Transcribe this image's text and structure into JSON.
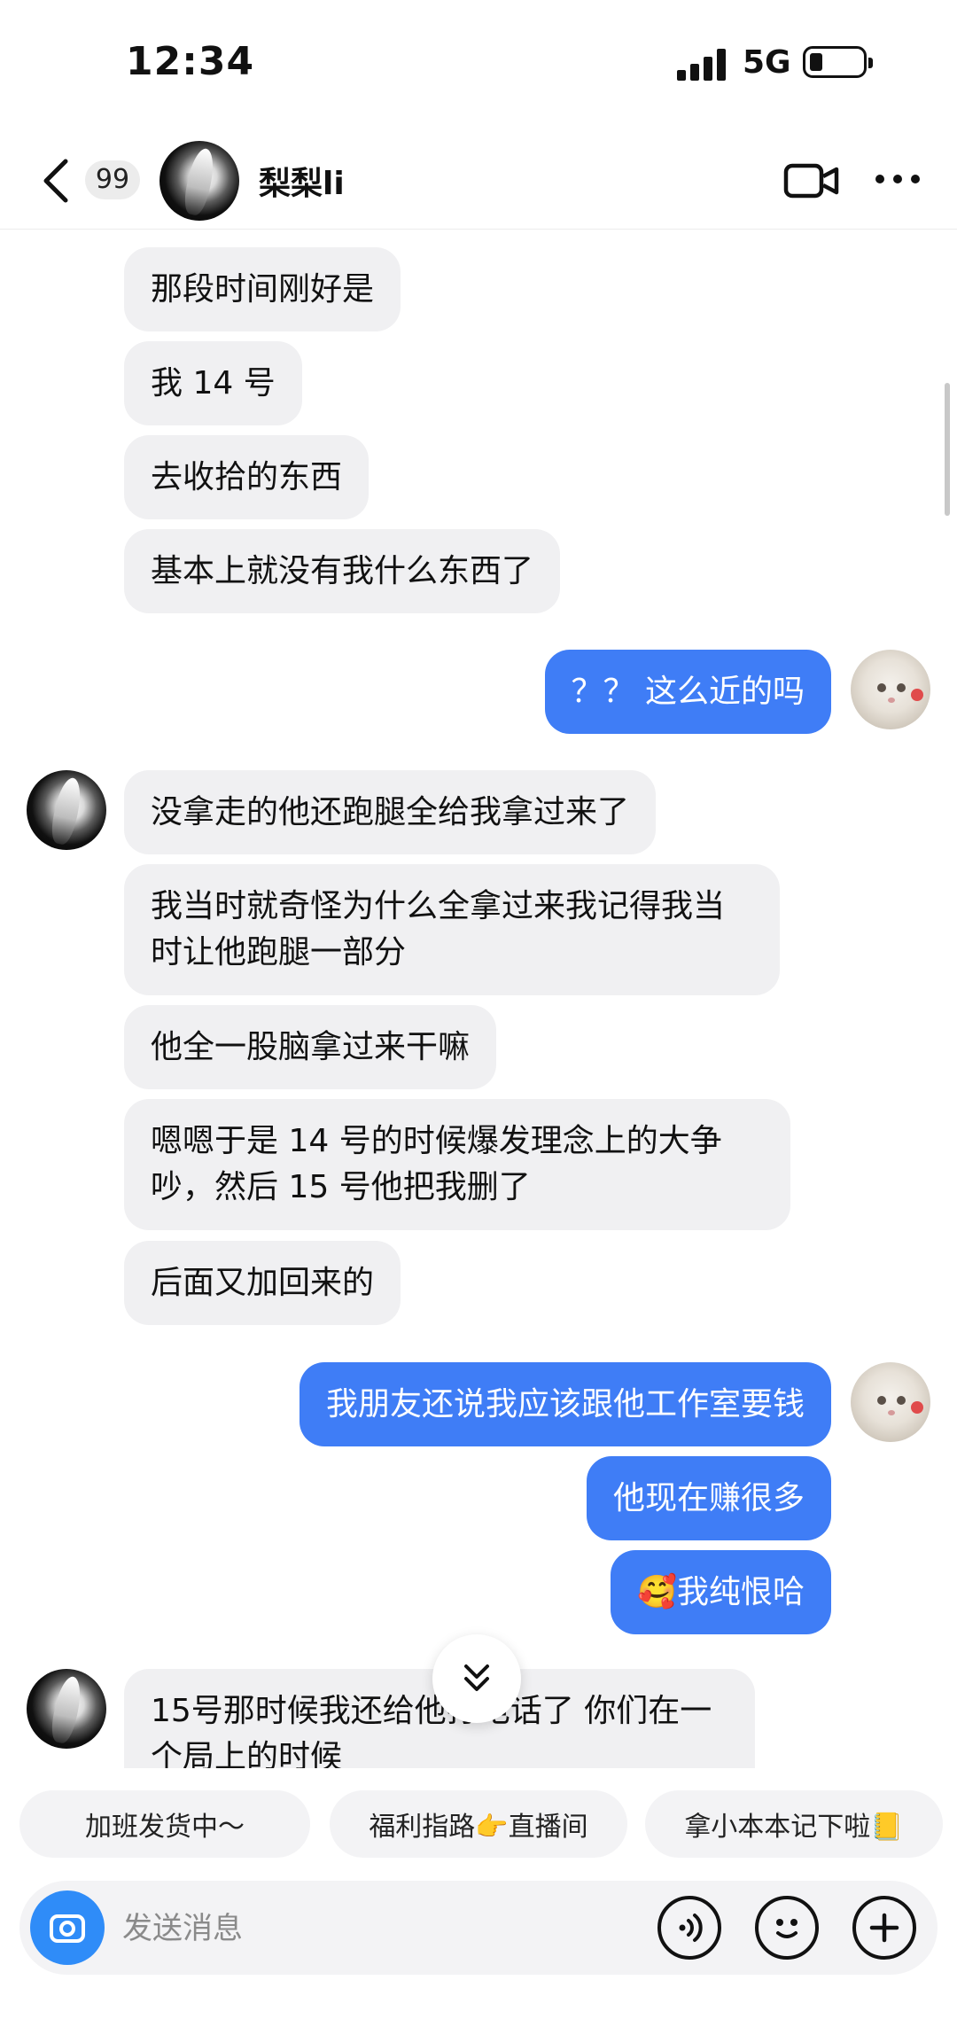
{
  "status": {
    "time": "12:34",
    "network": "5G"
  },
  "header": {
    "badge": "99",
    "name": "梨梨li"
  },
  "messages": [
    {
      "from": "them",
      "text": "那段时间刚好是"
    },
    {
      "from": "them",
      "text": "我 14 号"
    },
    {
      "from": "them",
      "text": "去收拾的东西"
    },
    {
      "from": "them",
      "text": "基本上就没有我什么东西了"
    },
    {
      "from": "me",
      "text": "？？ 这么近的吗"
    },
    {
      "from": "them",
      "text": "没拿走的他还跑腿全给我拿过来了"
    },
    {
      "from": "them",
      "text": "我当时就奇怪为什么全拿过来我记得我当时让他跑腿一部分"
    },
    {
      "from": "them",
      "text": "他全一股脑拿过来干嘛"
    },
    {
      "from": "them",
      "text": "嗯嗯于是 14 号的时候爆发理念上的大争吵，然后 15 号他把我删了"
    },
    {
      "from": "them",
      "text": "后面又加回来的"
    },
    {
      "from": "me",
      "text": "我朋友还说我应该跟他工作室要钱"
    },
    {
      "from": "me",
      "text": "他现在赚很多"
    },
    {
      "from": "me",
      "text": "🥰我纯恨哈"
    },
    {
      "from": "them",
      "text": "15号那时候我还给他打电话了 你们在一个局上的时候"
    }
  ],
  "quick_replies": [
    "加班发货中～",
    "福利指路👉直播间",
    "拿小本本记下啦📒"
  ],
  "input": {
    "placeholder": "发送消息",
    "value": ""
  },
  "colors": {
    "my_bubble": "#3f7df6",
    "their_bubble": "#f0f0f2",
    "camera_button": "#2f8cf8"
  }
}
